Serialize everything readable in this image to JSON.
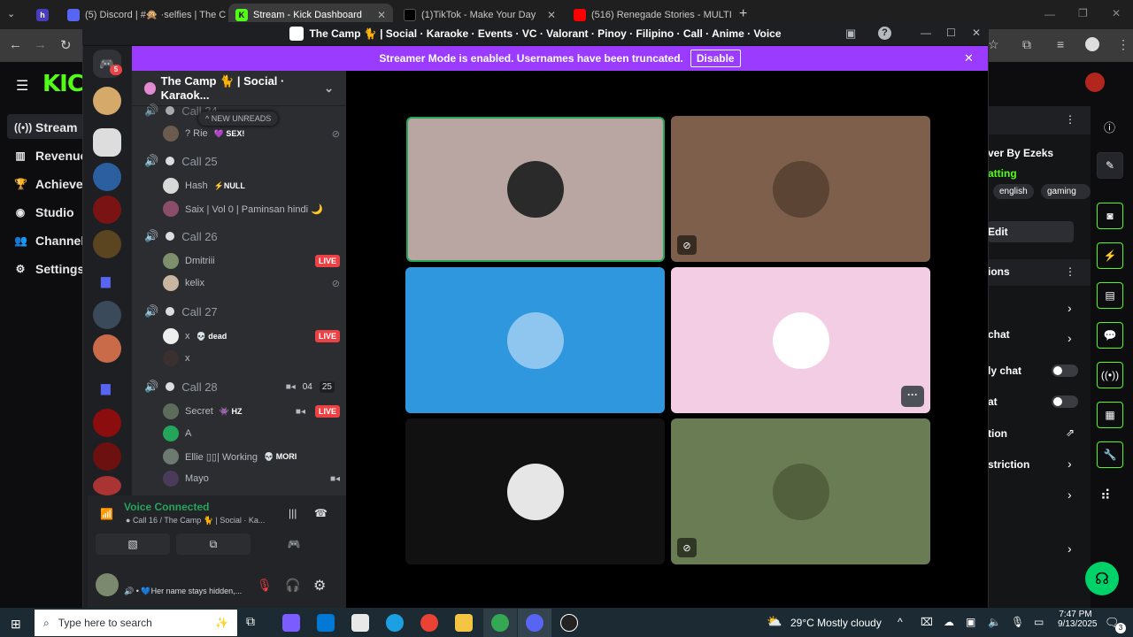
{
  "browser": {
    "tabs": [
      {
        "label": "(5) Discord | #🙊 ·selfies | The C",
        "active": false
      },
      {
        "label": "Stream - Kick Dashboard",
        "active": true
      },
      {
        "label": "(1)TikTok - Make Your Day",
        "active": false
      },
      {
        "label": "(516) Renegade Stories - MULTI",
        "active": false
      }
    ],
    "accent": "#53fc18"
  },
  "kick": {
    "logo": "KICK",
    "nav": [
      {
        "label": "Stream",
        "icon": "broadcast-icon"
      },
      {
        "label": "Revenue",
        "icon": "chart-icon"
      },
      {
        "label": "Achieve",
        "icon": "trophy-icon"
      },
      {
        "label": "Studio",
        "icon": "studio-icon"
      },
      {
        "label": "Channel",
        "icon": "people-icon"
      },
      {
        "label": "Settings",
        "icon": "gear-icon"
      }
    ],
    "right": {
      "title": "ver By Ezeks",
      "category": "atting",
      "tags": [
        "english",
        "gaming"
      ],
      "edit": "Edit",
      "section": "ions",
      "rows": [
        "chat",
        "ly chat",
        "at",
        "tion",
        "striction"
      ]
    }
  },
  "discord": {
    "window_title": "The Camp 🐈 | Social · Karaoke · Events · VC · Valorant · Pinoy · Filipino · Call · Anime · Voice",
    "banner_text": "Streamer Mode is enabled. Usernames have been truncated.",
    "banner_button": "Disable",
    "server_badge": "5",
    "server_name": "The Camp 🐈 | Social · Karaok...",
    "new_unreads": "NEW UNREADS",
    "calls": [
      {
        "name": "Call 24",
        "users": [
          {
            "name": "? Rie",
            "tag": "💜 SEX!",
            "live": false,
            "muted": true
          }
        ]
      },
      {
        "name": "Call 25",
        "users": [
          {
            "name": "Hash",
            "tag": "⚡NULL",
            "live": false,
            "muted": false
          },
          {
            "name": "Saix | Vol 0 | Paminsan hindi 🌙",
            "tag": "",
            "live": false,
            "muted": false
          }
        ]
      },
      {
        "name": "Call 26",
        "users": [
          {
            "name": "Dmitriii",
            "tag": "",
            "live": true,
            "muted": false
          },
          {
            "name": "kelix",
            "tag": "",
            "live": false,
            "muted": true
          }
        ]
      },
      {
        "name": "Call 27",
        "users": [
          {
            "name": "x",
            "tag": "💀 dead",
            "live": true,
            "muted": false
          },
          {
            "name": "x",
            "tag": "",
            "live": false,
            "muted": false
          }
        ]
      },
      {
        "name": "Call 28",
        "count_a": "04",
        "count_b": "25",
        "users": [
          {
            "name": "Secret",
            "tag": "👾 HZ",
            "live": true,
            "muted": false
          },
          {
            "name": "A",
            "tag": "",
            "live": false,
            "muted": false
          },
          {
            "name": "Ellie ▯▯| Working",
            "tag": "💀 MORI",
            "live": false,
            "muted": false
          },
          {
            "name": "Mayo",
            "tag": "",
            "live": false,
            "muted": false
          }
        ]
      }
    ],
    "live_label": "LIVE",
    "voice": {
      "status": "Voice Connected",
      "channel": "Call 16 / The Camp 🐈 | Social · Ka..."
    },
    "user_status": "💙Her name stays hidden,...",
    "tiles": [
      {
        "bg": "#b9a6a3",
        "speaking": true,
        "muted": false,
        "avatar": "#2a2a2a"
      },
      {
        "bg": "#7d5f4b",
        "speaking": false,
        "muted": true,
        "avatar": "#5b4433"
      },
      {
        "bg": "#2f97dd",
        "speaking": false,
        "muted": false,
        "avatar": "#8fc6ef"
      },
      {
        "bg": "#f2cde4",
        "speaking": false,
        "muted": false,
        "avatar": "#ffffff"
      },
      {
        "bg": "#111111",
        "speaking": false,
        "muted": true,
        "avatar": "#e6e6e6"
      },
      {
        "bg": "#6a7c53",
        "speaking": false,
        "muted": true,
        "avatar": "#52603d"
      }
    ]
  },
  "taskbar": {
    "search_placeholder": "Type here to search",
    "weather": "29°C  Mostly cloudy",
    "time": "7:47 PM",
    "date": "9/13/2025",
    "notif": "3"
  }
}
